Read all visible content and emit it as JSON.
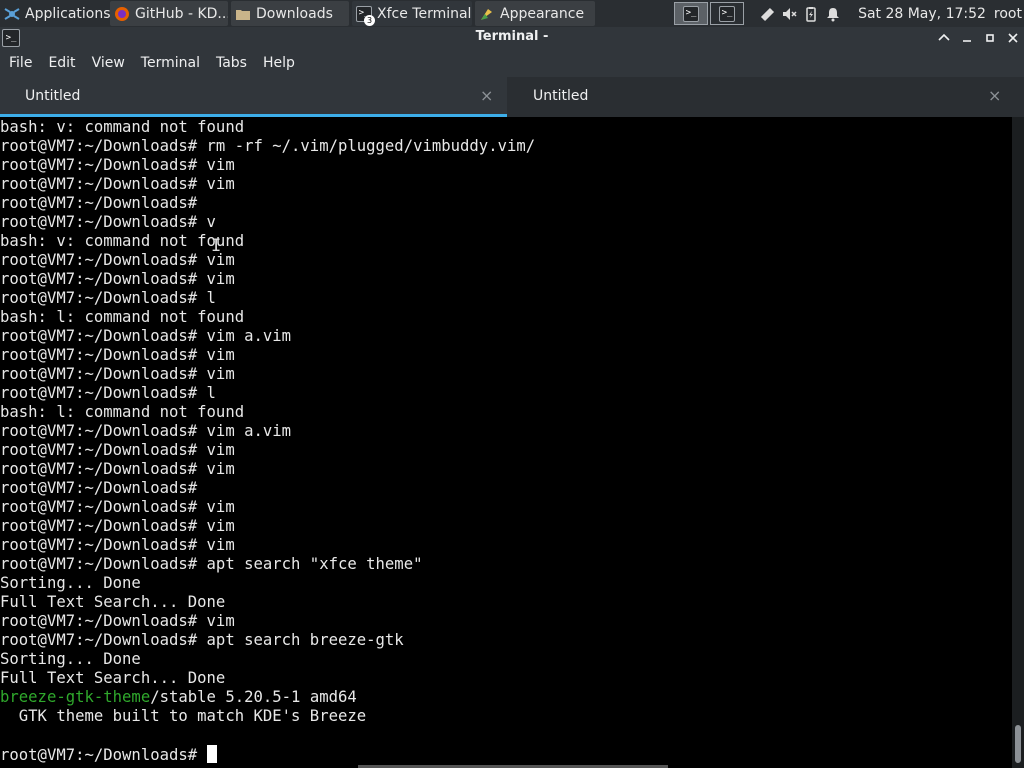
{
  "panel": {
    "applications_label": "Applications",
    "tasks": [
      {
        "label": "GitHub - KD...",
        "icon": "firefox-icon"
      },
      {
        "label": "Downloads",
        "icon": "folder-icon"
      },
      {
        "label": "Xfce Terminal",
        "icon": "terminal-icon",
        "badge": "3"
      },
      {
        "label": "Appearance",
        "icon": "appearance-icon"
      }
    ],
    "clock": "Sat 28 May, 17:52",
    "user": "root"
  },
  "window": {
    "title": "Terminal -",
    "icon": "terminal-icon"
  },
  "menu": [
    "File",
    "Edit",
    "View",
    "Terminal",
    "Tabs",
    "Help"
  ],
  "tabs": [
    {
      "label": "Untitled",
      "active": true
    },
    {
      "label": "Untitled",
      "active": false
    }
  ],
  "terminal": {
    "lines": [
      "bash: v: command not found",
      "root@VM7:~/Downloads# rm -rf ~/.vim/plugged/vimbuddy.vim/",
      "root@VM7:~/Downloads# vim",
      "root@VM7:~/Downloads# vim",
      "root@VM7:~/Downloads#",
      "root@VM7:~/Downloads# v",
      "bash: v: command not found",
      "root@VM7:~/Downloads# vim",
      "root@VM7:~/Downloads# vim",
      "root@VM7:~/Downloads# l",
      "bash: l: command not found",
      "root@VM7:~/Downloads# vim a.vim",
      "root@VM7:~/Downloads# vim",
      "root@VM7:~/Downloads# vim",
      "root@VM7:~/Downloads# l",
      "bash: l: command not found",
      "root@VM7:~/Downloads# vim a.vim",
      "root@VM7:~/Downloads# vim",
      "root@VM7:~/Downloads# vim",
      "root@VM7:~/Downloads#",
      "root@VM7:~/Downloads# vim",
      "root@VM7:~/Downloads# vim",
      "root@VM7:~/Downloads# vim",
      "root@VM7:~/Downloads# apt search \"xfce theme\"",
      "Sorting... Done",
      "Full Text Search... Done",
      "root@VM7:~/Downloads# vim",
      "root@VM7:~/Downloads# apt search breeze-gtk",
      "Sorting... Done",
      "Full Text Search... Done"
    ],
    "package_name": "breeze-gtk-theme",
    "package_rest": "/stable 5.20.5-1 amd64",
    "package_desc": "  GTK theme built to match KDE's Breeze",
    "prompt": "root@VM7:~/Downloads# ",
    "highlight_color": "#2fa82c"
  },
  "colors": {
    "accent": "#3daee9",
    "panel_bg": "#2a2e32",
    "window_bg": "#31363b"
  }
}
